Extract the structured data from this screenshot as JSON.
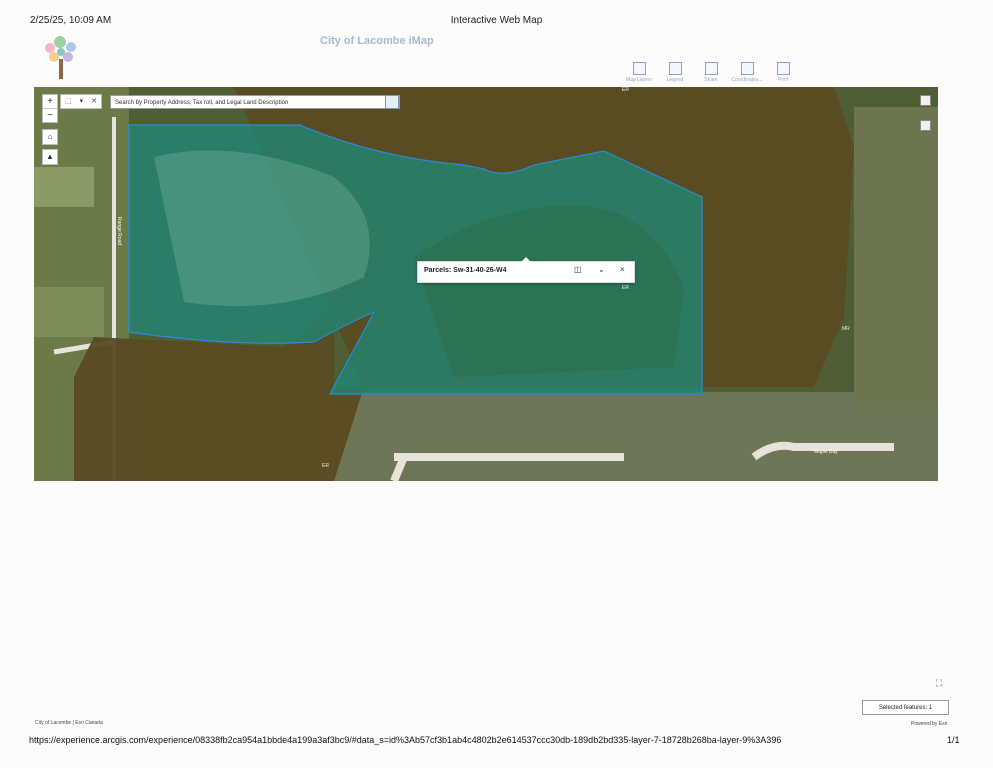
{
  "print_header": {
    "date": "2/25/25, 10:09 AM",
    "title": "Interactive Web Map"
  },
  "app": {
    "title": "City of Lacombe iMap",
    "toolbar": [
      "Map Layers",
      "Legend",
      "Share",
      "Coordinates...",
      "Print"
    ]
  },
  "map": {
    "search_placeholder": "Search by Property Address, Tax roll, and Legal Land Description",
    "zoom_in": "+",
    "zoom_out": "−",
    "popup_title": "Parcels: Sw-31-40-26-W4",
    "labels": {
      "er1": "ER",
      "er2": "ER",
      "er3": "ER",
      "mr": "MR",
      "street": "Maple Bay",
      "road_vertical": "Range Road"
    }
  },
  "status": {
    "selected_features": "Selected features: 1"
  },
  "footer": {
    "attribution": "City of Lacombe | Esri Canada",
    "powered_by": "Powered by Esri",
    "url": "https://experience.arcgis.com/experience/08338fb2ca954a1bbde4a199a3af3bc9/#data_s=id%3Ab57cf3b1ab4c4802b2e614537ccc30db-189db2bd335-layer-7-18728b268ba-layer-9%3A396",
    "page": "1/1"
  },
  "colors": {
    "parcel_fill": "#1d8a78",
    "parcel_outline": "#2a8ad8",
    "reserve_fill": "#5a4a22",
    "imagery": "#4a5a31"
  }
}
